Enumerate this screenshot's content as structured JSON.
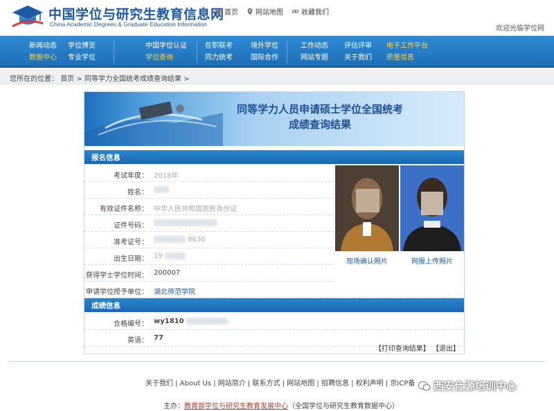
{
  "header": {
    "site_name": "中国学位与研究生教育信息网",
    "site_name_en": "China Academic Degrees & Graduate Education Information",
    "home": "首页",
    "sitemap": "网站地图",
    "bookmark": "收藏我们",
    "welcome": "欢迎光临学位网"
  },
  "nav": {
    "col1": [
      "新闻动态",
      "数据中心"
    ],
    "col2": [
      "学位博览",
      "专业学位"
    ],
    "col3": [
      "中国学位认证",
      "学位查询"
    ],
    "col4": [
      "在职联考",
      "同力统考"
    ],
    "col5": [
      "境外学位",
      "国际合作"
    ],
    "col6": [
      "工作动态",
      "网站专题"
    ],
    "col7": [
      "评估评审",
      "关于我们"
    ],
    "col8": [
      "电子工作平台",
      "质量信息"
    ]
  },
  "breadcrumb": {
    "prefix": "您所在的位置：",
    "home": "首页",
    "sep": ">",
    "current": "同等学力全国统考成绩查询结果"
  },
  "banner": {
    "title_line1": "同等学力人员申请硕士学位全国统考",
    "title_line2": "成绩查询结果"
  },
  "signup": {
    "title": "报名信息",
    "fields": [
      {
        "label": "考试年度：",
        "value": "2018年"
      },
      {
        "label": "姓名：",
        "value": ""
      },
      {
        "label": "有效证件名称：",
        "value": "中华人民共和国居民身份证"
      },
      {
        "label": "证件号码：",
        "value": ""
      },
      {
        "label": "准考证号：",
        "value": "8630"
      },
      {
        "label": "出生日期：",
        "value": "19"
      },
      {
        "label": "获得学士学位时间：",
        "value": "200007"
      },
      {
        "label": "申请学位授予单位：",
        "value": "湖北师范学院"
      }
    ],
    "photo1_caption": "现场确认照片",
    "photo2_caption": "网报上传照片"
  },
  "scores": {
    "title": "成绩信息",
    "fields": [
      {
        "label": "合格编号：",
        "value": "wy1810"
      },
      {
        "label": "英语：",
        "value": "77"
      }
    ]
  },
  "actions": {
    "print": "【打印查询结果】",
    "exit": "【退出】"
  },
  "footer": {
    "links": [
      "关于我们",
      "About Us",
      "网站简介",
      "联系方式",
      "网站地图",
      "招聘信息",
      "权利声明",
      "京ICP备"
    ],
    "host_prefix": "主办：",
    "host_link": "教育部学位与研究生教育发展中心",
    "host_suffix": "（全国学位与研究生教育数据中心）",
    "watermark": "西安仕源培训中心"
  },
  "colors": {
    "brand_blue": "#1d5aa8",
    "nav_blue": "#2a7fc9",
    "nav_highlight": "#ffd23a"
  }
}
